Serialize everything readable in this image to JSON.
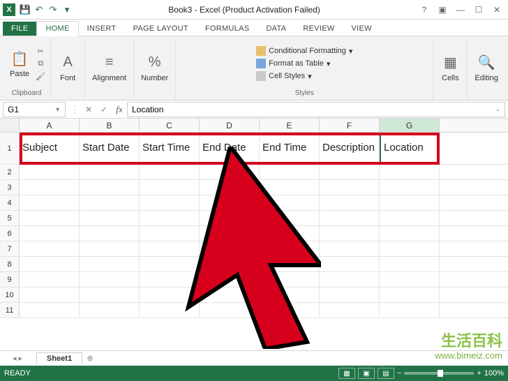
{
  "window": {
    "title": "Book3 - Excel (Product Activation Failed)",
    "excel_glyph": "X"
  },
  "tabs": {
    "file": "FILE",
    "home": "HOME",
    "insert": "INSERT",
    "page_layout": "PAGE LAYOUT",
    "formulas": "FORMULAS",
    "data": "DATA",
    "review": "REVIEW",
    "view": "VIEW"
  },
  "ribbon": {
    "clipboard": {
      "label": "Clipboard",
      "paste": "Paste"
    },
    "font": {
      "label": "Font"
    },
    "alignment": {
      "label": "Alignment"
    },
    "number": {
      "label": "Number"
    },
    "styles": {
      "label": "Styles",
      "cond_fmt": "Conditional Formatting",
      "fmt_table": "Format as Table",
      "cell_styles": "Cell Styles"
    },
    "cells": {
      "label": "Cells"
    },
    "editing": {
      "label": "Editing"
    }
  },
  "namebox": "G1",
  "formula_value": "Location",
  "columns": [
    "A",
    "B",
    "C",
    "D",
    "E",
    "F",
    "G"
  ],
  "selected_column_index": 6,
  "headers_row": [
    "Subject",
    "Start Date",
    "Start Time",
    "End Date",
    "End Time",
    "Description",
    "Location"
  ],
  "row_numbers": [
    1,
    2,
    3,
    4,
    5,
    6,
    7,
    8,
    9,
    10,
    11
  ],
  "sheet": {
    "name": "Sheet1"
  },
  "status": {
    "ready": "READY",
    "zoom": "100%"
  },
  "watermark": {
    "cn": "生活百科",
    "url": "www.bimeiz.com"
  }
}
